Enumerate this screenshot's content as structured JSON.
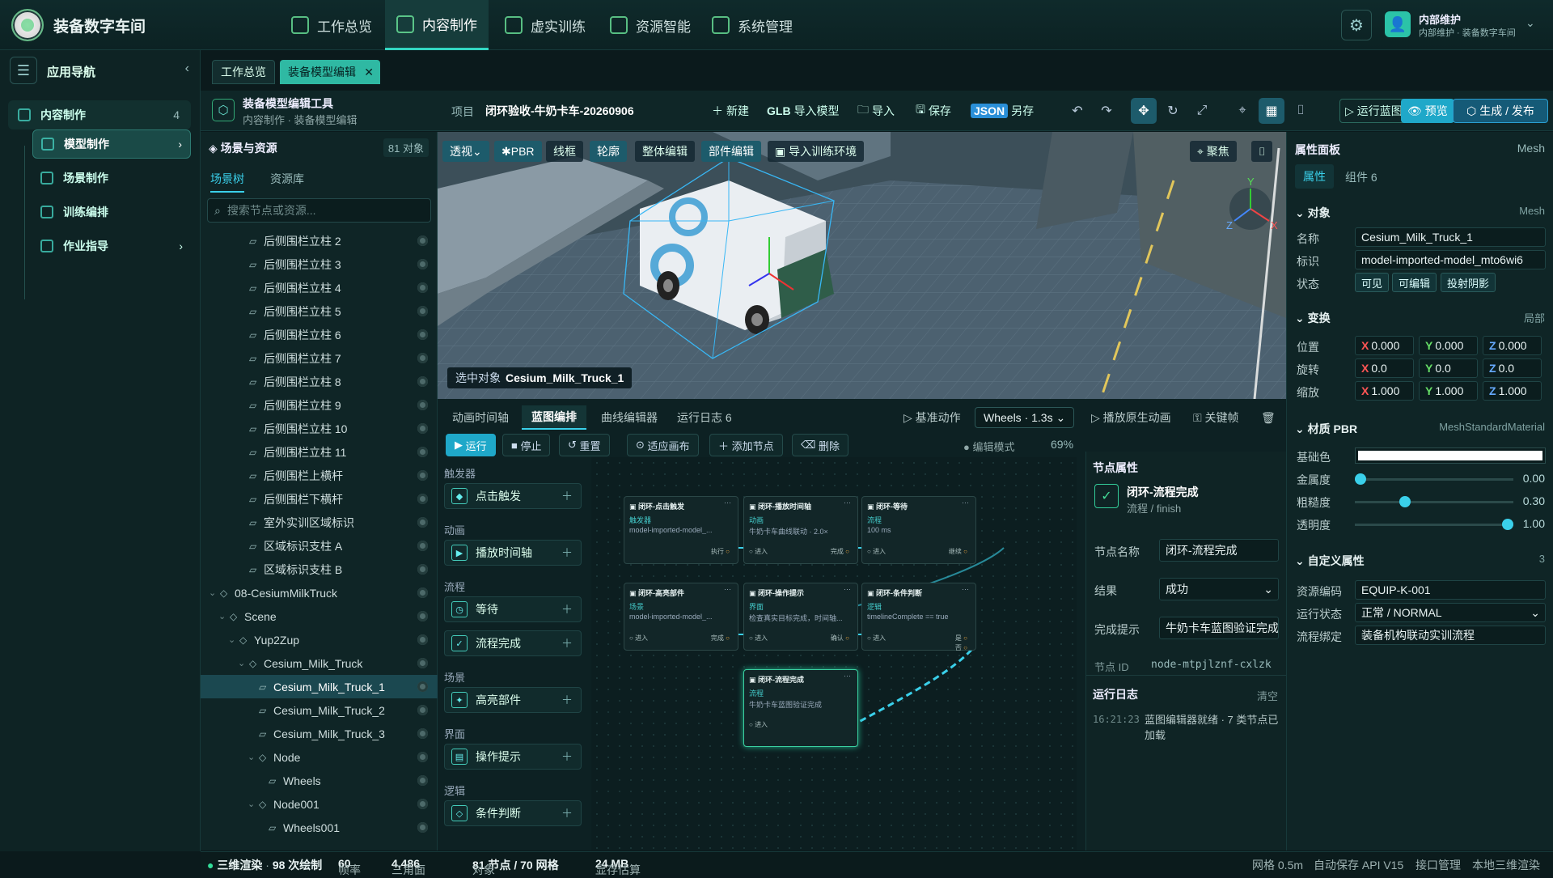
{
  "app": {
    "name": "装备数字车间"
  },
  "topnav": [
    {
      "label": "工作总览",
      "active": false
    },
    {
      "label": "内容制作",
      "active": true
    },
    {
      "label": "虚实训练",
      "active": false
    },
    {
      "label": "资源智能",
      "active": false
    },
    {
      "label": "系统管理",
      "active": false
    }
  ],
  "user": {
    "name": "内部维护",
    "sub": "内部维护 · 装备数字车间"
  },
  "leftnav": {
    "title": "应用导航",
    "section": {
      "label": "内容制作",
      "count": "4"
    },
    "items": [
      {
        "label": "模型制作",
        "active": true
      },
      {
        "label": "场景制作"
      },
      {
        "label": "训练编排"
      },
      {
        "label": "作业指导"
      }
    ]
  },
  "doc_tabs": [
    "工作总览",
    "装备模型编辑"
  ],
  "header": {
    "tool_title": "装备模型编辑工具",
    "breadcrumb": "内容制作 · 装备模型编辑",
    "project_label": "项目",
    "project_name": "闭环验收-牛奶卡车-20260906",
    "new": "新建",
    "glb_tag": "GLB",
    "import_model": "导入模型",
    "import": "导入",
    "save": "保存",
    "json_tag": "JSON",
    "save_as": "另存",
    "run_blueprint": "运行蓝图",
    "preview": "预览",
    "publish": "生成 / 发布"
  },
  "scene": {
    "title": "场景与资源",
    "count": "81 对象",
    "tabs": [
      "场景树",
      "资源库"
    ],
    "search_placeholder": "搜索节点或资源...",
    "nodes": [
      {
        "label": "后侧围栏立柱 2",
        "depth": 3,
        "kind": "mesh"
      },
      {
        "label": "后侧围栏立柱 3",
        "depth": 3,
        "kind": "mesh"
      },
      {
        "label": "后侧围栏立柱 4",
        "depth": 3,
        "kind": "mesh"
      },
      {
        "label": "后侧围栏立柱 5",
        "depth": 3,
        "kind": "mesh"
      },
      {
        "label": "后侧围栏立柱 6",
        "depth": 3,
        "kind": "mesh"
      },
      {
        "label": "后侧围栏立柱 7",
        "depth": 3,
        "kind": "mesh"
      },
      {
        "label": "后侧围栏立柱 8",
        "depth": 3,
        "kind": "mesh"
      },
      {
        "label": "后侧围栏立柱 9",
        "depth": 3,
        "kind": "mesh"
      },
      {
        "label": "后侧围栏立柱 10",
        "depth": 3,
        "kind": "mesh"
      },
      {
        "label": "后侧围栏立柱 11",
        "depth": 3,
        "kind": "mesh"
      },
      {
        "label": "后侧围栏上横杆",
        "depth": 3,
        "kind": "mesh"
      },
      {
        "label": "后侧围栏下横杆",
        "depth": 3,
        "kind": "mesh"
      },
      {
        "label": "室外实训区域标识",
        "depth": 3,
        "kind": "mesh"
      },
      {
        "label": "区域标识支柱 A",
        "depth": 3,
        "kind": "mesh"
      },
      {
        "label": "区域标识支柱 B",
        "depth": 3,
        "kind": "mesh"
      },
      {
        "label": "08-CesiumMilkTruck",
        "depth": 0,
        "kind": "group"
      },
      {
        "label": "Scene",
        "depth": 1,
        "kind": "group"
      },
      {
        "label": "Yup2Zup",
        "depth": 2,
        "kind": "group"
      },
      {
        "label": "Cesium_Milk_Truck",
        "depth": 3,
        "kind": "group"
      },
      {
        "label": "Cesium_Milk_Truck_1",
        "depth": 4,
        "kind": "mesh",
        "selected": true
      },
      {
        "label": "Cesium_Milk_Truck_2",
        "depth": 4,
        "kind": "mesh"
      },
      {
        "label": "Cesium_Milk_Truck_3",
        "depth": 4,
        "kind": "mesh"
      },
      {
        "label": "Node",
        "depth": 4,
        "kind": "group"
      },
      {
        "label": "Wheels",
        "depth": 5,
        "kind": "mesh"
      },
      {
        "label": "Node001",
        "depth": 4,
        "kind": "group"
      },
      {
        "label": "Wheels001",
        "depth": 5,
        "kind": "mesh"
      }
    ]
  },
  "viewport": {
    "buttons": [
      "透视",
      "PBR",
      "线框",
      "轮廓",
      "整体编辑",
      "部件编辑",
      "导入训练环境"
    ],
    "focus": "聚焦",
    "selected_label": "选中对象",
    "selected_name": "Cesium_Milk_Truck_1"
  },
  "bottom": {
    "tabs": [
      "动画时间轴",
      "蓝图编排",
      "曲线编辑器",
      "运行日志 6"
    ],
    "base_action": "基准动作",
    "anim_select": "Wheels · 1.3s",
    "play_original": "播放原生动画",
    "keyframe": "关键帧",
    "tools": [
      "运行",
      "停止",
      "重置",
      "适应画布",
      "添加节点",
      "删除"
    ],
    "mode": "编辑模式",
    "zoom": "69%",
    "palette": [
      {
        "cat": "触发器",
        "item": "点击触发"
      },
      {
        "cat": "动画",
        "item": "播放时间轴"
      },
      {
        "cat": "流程",
        "item": "等待"
      },
      {
        "cat": "",
        "item": "流程完成"
      },
      {
        "cat": "场景",
        "item": "高亮部件"
      },
      {
        "cat": "界面",
        "item": "操作提示"
      },
      {
        "cat": "逻辑",
        "item": "条件判断"
      }
    ]
  },
  "nodes": [
    {
      "title": "闭环-点击触发",
      "cat": "触发器",
      "desc": "model-imported-model_...",
      "in": "",
      "out": "执行"
    },
    {
      "title": "闭环-播放时间轴",
      "cat": "动画",
      "desc": "牛奶卡车曲线联动 · 2.0×",
      "in": "进入",
      "out": "完成"
    },
    {
      "title": "闭环-等待",
      "cat": "流程",
      "desc": "100 ms",
      "in": "进入",
      "out": "继续"
    },
    {
      "title": "闭环-高亮部件",
      "cat": "场景",
      "desc": "model-imported-model_...",
      "in": "进入",
      "out": "完成"
    },
    {
      "title": "闭环-操作提示",
      "cat": "界面",
      "desc": "检查真实目标完成，时间轴...",
      "in": "进入",
      "out": "确认"
    },
    {
      "title": "闭环-条件判断",
      "cat": "逻辑",
      "desc": "timelineComplete == true",
      "in": "进入",
      "out": "是",
      "out2": "否"
    },
    {
      "title": "闭环-流程完成",
      "cat": "流程",
      "desc": "牛奶卡车蓝图验证完成",
      "in": "进入",
      "out": ""
    }
  ],
  "node_props": {
    "title": "节点属性",
    "node_name": "闭环-流程完成",
    "node_sub": "流程 / finish",
    "name_label": "节点名称",
    "name_value": "闭环-流程完成",
    "result_label": "结果",
    "result_value": "成功",
    "hint_label": "完成提示",
    "hint_value": "牛奶卡车蓝图验证完成",
    "id_label": "节点 ID",
    "id_value": "node-mtpjlznf-cxlzk",
    "log_title": "运行日志",
    "log_clear": "清空",
    "log_time": "16:21:23",
    "log_text": "蓝图编辑器就绪 · 7 类节点已加载"
  },
  "props": {
    "title": "属性面板",
    "type": "Mesh",
    "tabs": [
      "属性",
      "组件 6"
    ],
    "object": {
      "label": "对象",
      "right": "Mesh",
      "name_label": "名称",
      "name": "Cesium_Milk_Truck_1",
      "id_label": "标识",
      "id": "model-imported-model_mto6wi6",
      "state_label": "状态",
      "states": [
        "可见",
        "可编辑",
        "投射阴影"
      ]
    },
    "transform": {
      "label": "变换",
      "right": "局部",
      "rows": [
        {
          "label": "位置",
          "x": "0.000",
          "y": "0.000",
          "z": "0.000"
        },
        {
          "label": "旋转",
          "x": "0.0",
          "y": "0.0",
          "z": "0.0"
        },
        {
          "label": "缩放",
          "x": "1.000",
          "y": "1.000",
          "z": "1.000"
        }
      ]
    },
    "material": {
      "label": "材质 PBR",
      "right": "MeshStandardMaterial",
      "base_label": "基础色",
      "sliders": [
        {
          "label": "金属度",
          "value": 0.0,
          "text": "0.00"
        },
        {
          "label": "粗糙度",
          "value": 0.3,
          "text": "0.30"
        },
        {
          "label": "透明度",
          "value": 1.0,
          "text": "1.00"
        }
      ]
    },
    "custom": {
      "label": "自定义属性",
      "count": "3",
      "rows": [
        {
          "label": "资源编码",
          "value": "EQUIP-K-001"
        },
        {
          "label": "运行状态",
          "value": "正常 / NORMAL"
        },
        {
          "label": "流程绑定",
          "value": "装备机构联动实训流程"
        }
      ]
    }
  },
  "status": {
    "render": "三维渲染",
    "draws": "98 次绘制",
    "fps_label": "帧率",
    "fps": "60",
    "tris_label": "三角面",
    "tris": "4,486",
    "objs_label": "对象",
    "objs": "81 节点 / 70 网格",
    "mem_label": "显存估算",
    "mem": "24 MB",
    "grid": "网格 0.5m",
    "autosave": "自动保存 API V15",
    "api": "接口管理",
    "local": "本地三维渲染"
  },
  "colors": {
    "accent": "#33d6c2",
    "cyan": "#3ad0ea",
    "bg": "#0b1a1c"
  }
}
